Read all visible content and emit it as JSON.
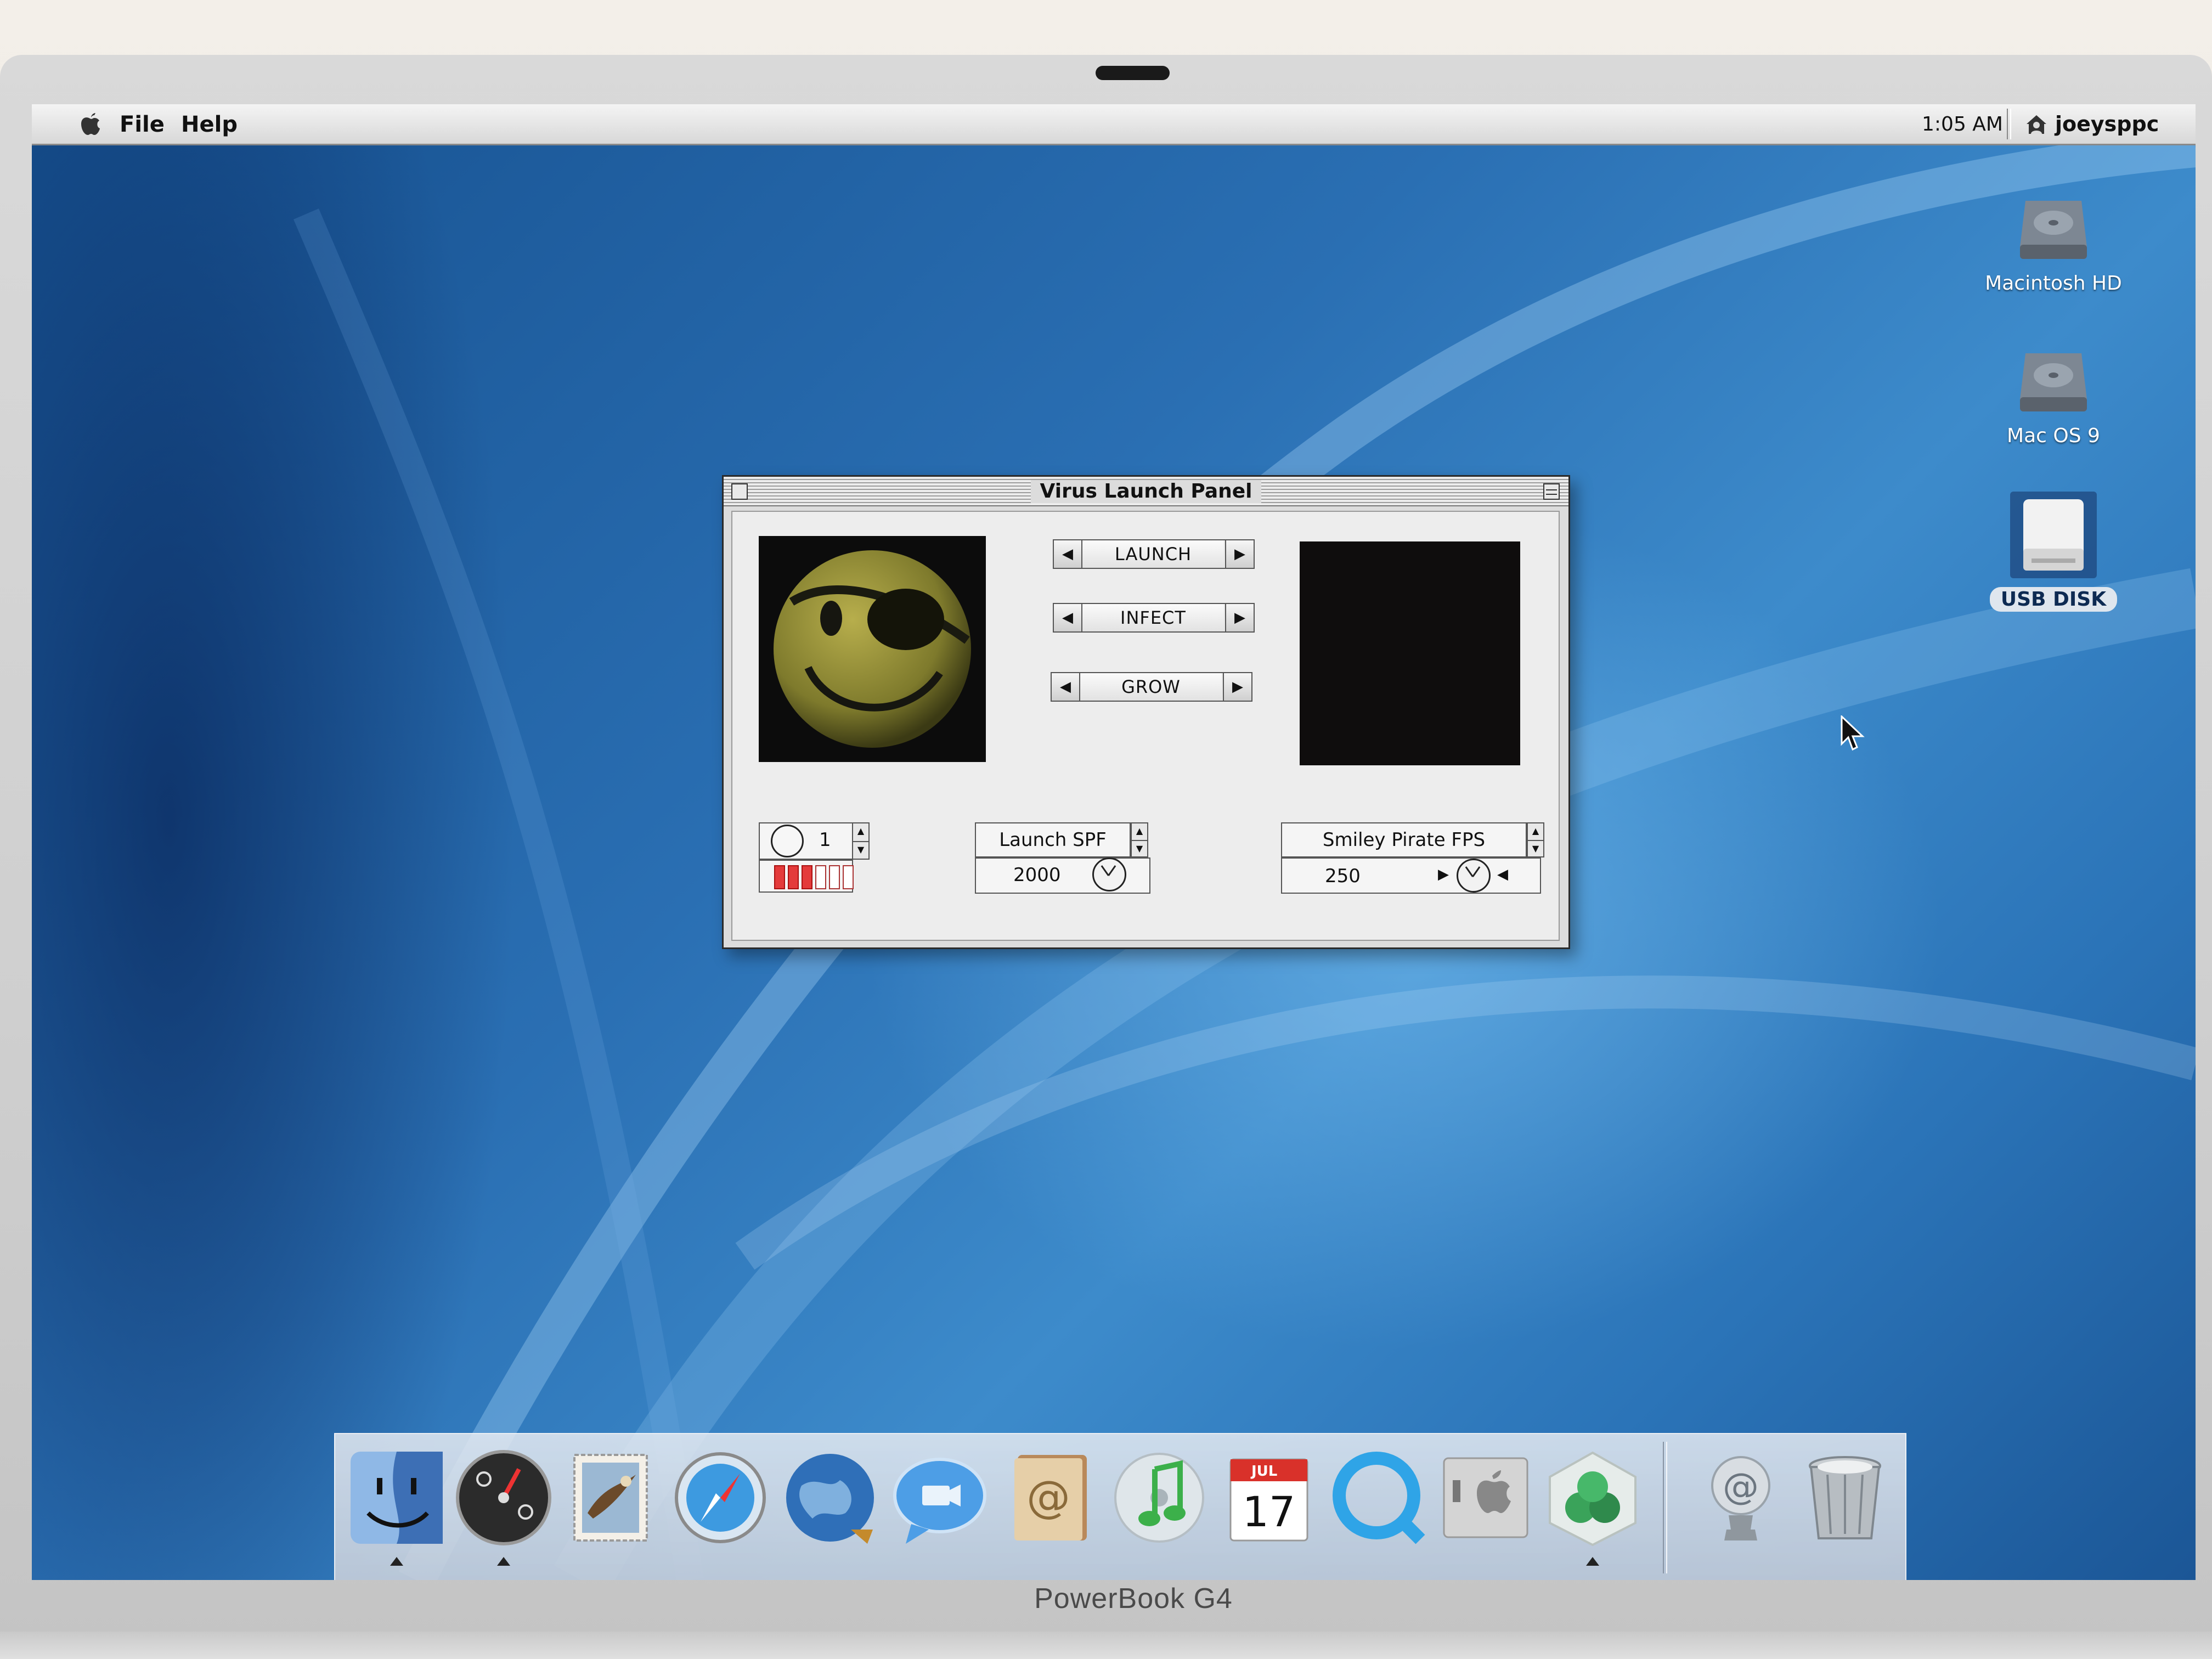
{
  "menubar": {
    "menus": [
      "File",
      "Help"
    ],
    "clock": "1:05 AM",
    "user": "joeysppc"
  },
  "desktop": {
    "icons": [
      {
        "label": "Macintosh HD",
        "icon": "hard-drive-icon"
      },
      {
        "label": "Mac OS 9",
        "icon": "hard-drive-icon"
      },
      {
        "label": "USB DISK",
        "icon": "usb-disk-icon",
        "selected": true
      }
    ]
  },
  "window": {
    "title": "Virus Launch Panel",
    "buttons": {
      "launch": "LAUNCH",
      "infect": "INFECT",
      "grow": "GROW"
    },
    "counter": {
      "value": "1",
      "meter_filled": 3,
      "meter_total": 6
    },
    "launch_spf": {
      "label": "Launch SPF",
      "value": "2000"
    },
    "smiley_fps": {
      "label": "Smiley Pirate FPS",
      "value": "250"
    }
  },
  "dock": {
    "apps": [
      {
        "icon": "finder-icon",
        "running": true
      },
      {
        "icon": "dashboard-icon",
        "running": true
      },
      {
        "icon": "mail-icon",
        "running": false
      },
      {
        "icon": "safari-icon",
        "running": false
      },
      {
        "icon": "network-globe-icon",
        "running": false
      },
      {
        "icon": "ichat-icon",
        "running": false
      },
      {
        "icon": "address-book-icon",
        "running": false
      },
      {
        "icon": "itunes-icon",
        "running": false
      },
      {
        "icon": "ical-icon",
        "running": false,
        "month": "JUL",
        "day": "17"
      },
      {
        "icon": "quicktime-icon",
        "running": false
      },
      {
        "icon": "system-preferences-icon",
        "running": false
      },
      {
        "icon": "classic-app-icon",
        "running": true
      }
    ],
    "others": [
      {
        "icon": "internet-connect-icon"
      },
      {
        "icon": "trash-icon"
      }
    ]
  },
  "bezel": {
    "model": "PowerBook G4"
  },
  "colors": {
    "wallpaper": "#2a6fb3",
    "meter_on": "#e43b3b"
  }
}
